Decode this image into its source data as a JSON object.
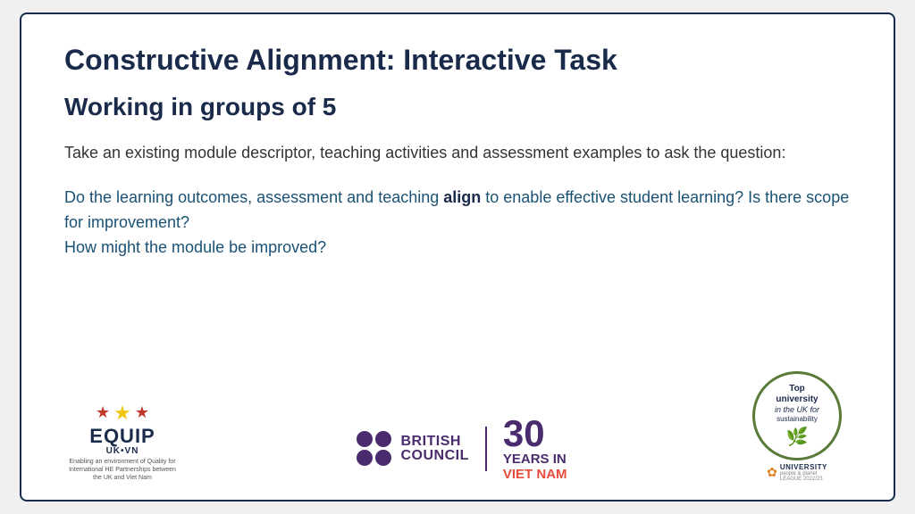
{
  "slide": {
    "title": "Constructive Alignment: Interactive Task",
    "subtitle": "Working in groups of 5",
    "paragraph1": "Take an existing module descriptor, teaching activities and assessment examples to ask the question:",
    "paragraph2_part1": "Do the learning outcomes, assessment and teaching ",
    "paragraph2_bold": "align",
    "paragraph2_part2": " to enable effective student learning? Is there scope for improvement?\nHow might the module be improved?"
  },
  "footer": {
    "equip": {
      "stars_label": "★ ★ ★",
      "title": "EQUIP",
      "subtitle": "UK•VN",
      "description": "Enabling an environment of Quality for International HE Partnerships between the UK and Viet Nam"
    },
    "british_council": {
      "name_line1": "BRITISH",
      "name_line2": "COUNCIL",
      "years_number": "30",
      "years_text": "YEARS IN",
      "country": "VIET NAM"
    },
    "sustainability": {
      "top": "Top",
      "university": "university",
      "in_the_uk": "in the UK for",
      "sustainability_text": "sustainability",
      "league_title": "UNIVERSITY",
      "league_sub": "people & planet",
      "league_year": "LEAGUE 2022/23"
    }
  }
}
